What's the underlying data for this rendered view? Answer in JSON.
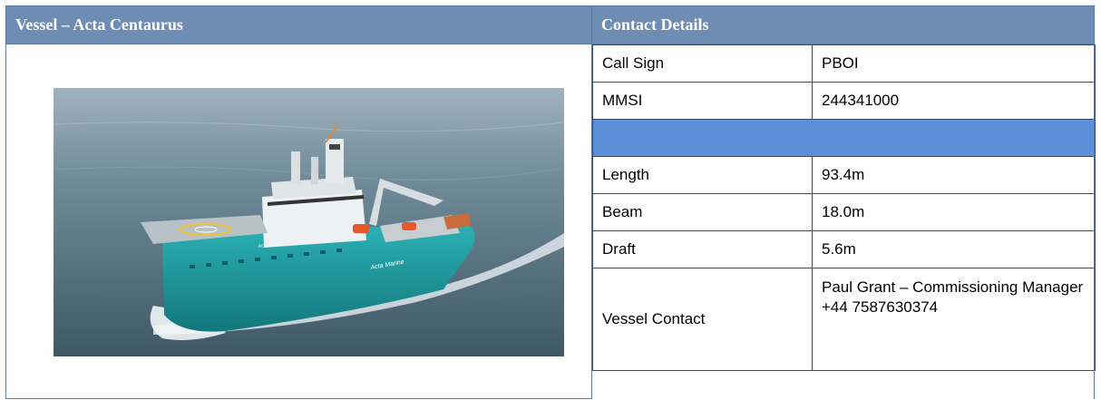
{
  "vessel": {
    "header": "Vessel – Acta Centaurus",
    "hull_text": "ACTA CENTAURUS",
    "brand_text": "Acta Marine"
  },
  "contact": {
    "header": "Contact Details",
    "rows": [
      {
        "label": "Call Sign",
        "value": "PBOI"
      },
      {
        "label": "MMSI",
        "value": "244341000"
      },
      {
        "label": "",
        "value": ""
      },
      {
        "label": "Length",
        "value": "93.4m"
      },
      {
        "label": "Beam",
        "value": "18.0m"
      },
      {
        "label": "Draft",
        "value": "5.6m"
      },
      {
        "label": "Vessel Contact",
        "value": "Paul Grant – Commissioning Manager    +44 7587630374"
      }
    ]
  },
  "colors": {
    "header_bg": "#6f8db4",
    "header_text": "#ffffff",
    "separator_row": "#5b8fd8",
    "hull": "#1e9aa0"
  }
}
